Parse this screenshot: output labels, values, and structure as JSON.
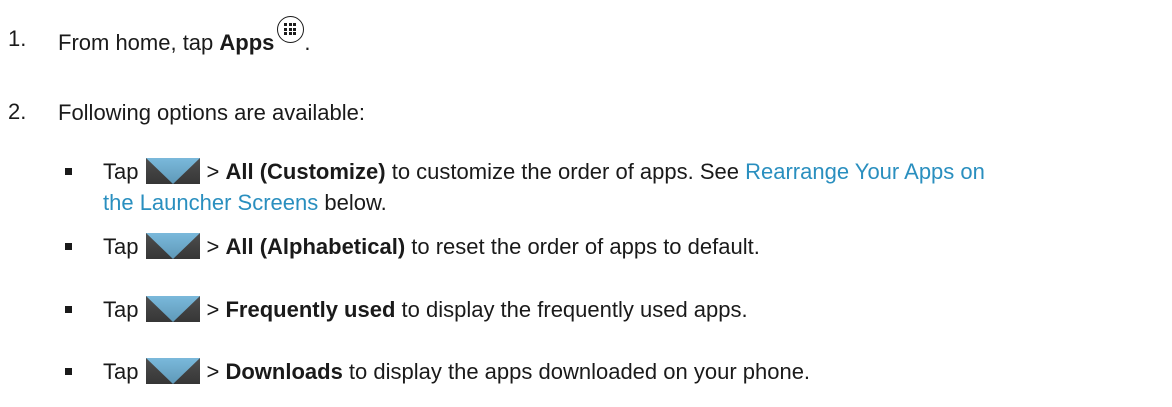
{
  "step1": {
    "number": "1.",
    "text_before": "From home, tap ",
    "bold": "Apps",
    "text_after": ".",
    "icon": "apps-grid-icon"
  },
  "step2": {
    "number": "2.",
    "text": "Following options are available:"
  },
  "options": [
    {
      "tap": "Tap",
      "gt": ">",
      "bold": "All (Customize)",
      "text": " to customize the order of apps. See ",
      "link_line1": "Rearrange Your Apps on",
      "link_line2": "the Launcher Screens",
      "text_end": " below."
    },
    {
      "tap": "Tap",
      "gt": ">",
      "bold": "All (Alphabetical)",
      "text": " to reset the order of apps to default."
    },
    {
      "tap": "Tap",
      "gt": ">",
      "bold": "Frequently used",
      "text": " to display the frequently used apps."
    },
    {
      "tap": "Tap",
      "gt": ">",
      "bold": "Downloads",
      "text": " to display the apps downloaded on your phone."
    }
  ],
  "colors": {
    "link": "#2a8fbf",
    "menu_icon_bg": "#3f3f3f",
    "menu_icon_triangle": "#6fb3d8"
  },
  "icons": {
    "menu": "menu-dropdown-icon"
  }
}
